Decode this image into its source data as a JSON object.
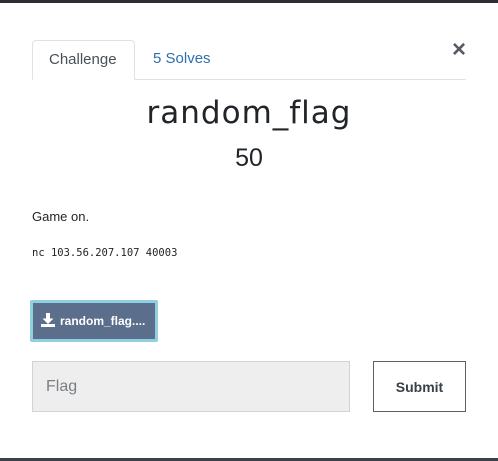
{
  "modal": {
    "close_label": "×",
    "tabs": [
      {
        "label": "Challenge"
      },
      {
        "label": "5 Solves"
      }
    ],
    "challenge": {
      "name": "random_flag",
      "value": "50",
      "description": "Game on.",
      "connection": "nc 103.56.207.107 40003",
      "file_label": "random_flag...."
    },
    "flag_form": {
      "placeholder": "Flag",
      "value": "",
      "submit_label": "Submit"
    }
  },
  "icons": {
    "download": "download-icon",
    "close": "close-icon"
  },
  "colors": {
    "tab_link": "#2f6fae",
    "file_button": "#5b6e8c",
    "file_button_border": "#8fcfe0",
    "input_background": "#eeeeee"
  }
}
